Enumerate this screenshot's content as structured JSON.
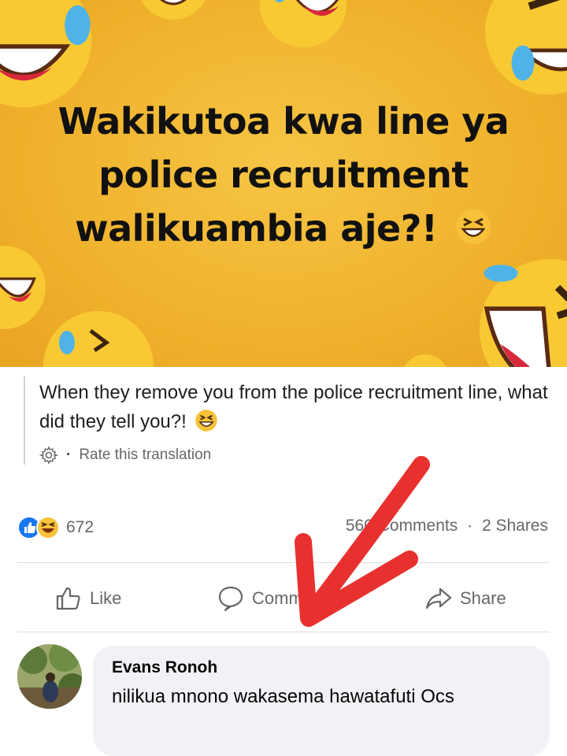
{
  "post": {
    "image_title_lines": [
      "Wakikutoa kwa line ya",
      "police recruitment",
      "walikuambia aje?!"
    ],
    "translated_text": "When they remove you from the police recruitment line, what did they tell you?!",
    "rate_translation": "Rate this translation",
    "rate_separator": "·",
    "reaction_count": "672",
    "comments_label": "560 Comments",
    "shares_label": "2 Shares",
    "engagement_separator": "·"
  },
  "actions": {
    "like_label": "Like",
    "comment_label": "Comment",
    "share_label": "Share"
  },
  "comment": {
    "author": "Evans Ronoh",
    "text": "nilikua mnono wakasema hawatafuti Ocs"
  },
  "colors": {
    "banner_yellow": "#f0b22c",
    "like_blue": "#1877f2",
    "arrow_red": "#e8312f",
    "muted_text": "#65676b"
  },
  "icons": [
    "laughing-emoji-icon",
    "like-reaction-icon",
    "haha-reaction-icon",
    "gear-icon",
    "thumbs-up-icon",
    "comment-bubble-icon",
    "share-arrow-icon"
  ]
}
